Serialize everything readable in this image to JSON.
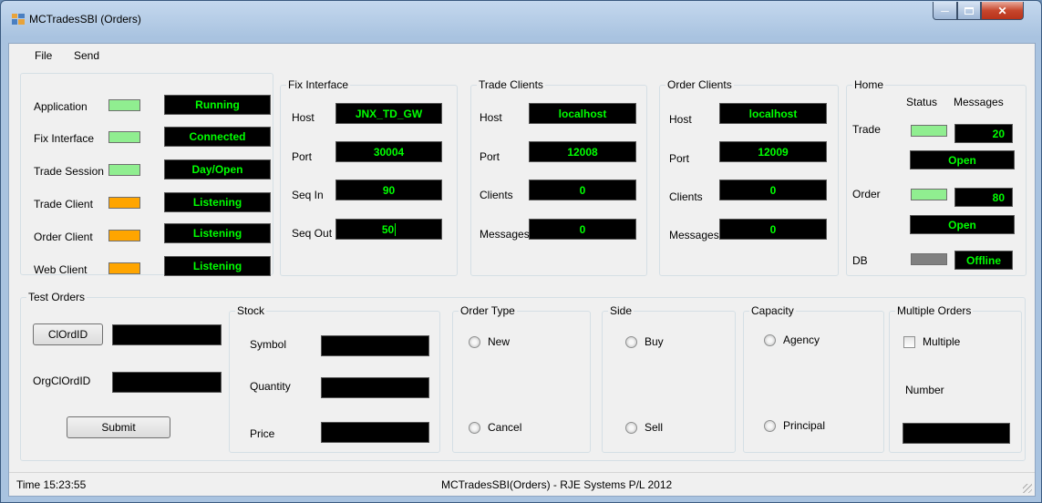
{
  "window": {
    "title": "MCTradesSBI (Orders)"
  },
  "menu": [
    "File",
    "Send"
  ],
  "status_panel": {
    "rows": [
      {
        "label": "Application",
        "led": "green",
        "value": "Running"
      },
      {
        "label": "Fix Interface",
        "led": "green",
        "value": "Connected"
      },
      {
        "label": "Trade Session",
        "led": "green",
        "value": "Day/Open"
      },
      {
        "label": "Trade Client",
        "led": "orange",
        "value": "Listening"
      },
      {
        "label": "Order Client",
        "led": "orange",
        "value": "Listening"
      },
      {
        "label": "Web Client",
        "led": "orange",
        "value": "Listening"
      }
    ]
  },
  "fix_interface": {
    "title": "Fix Interface",
    "host_label": "Host",
    "host": "JNX_TD_GW",
    "port_label": "Port",
    "port": "30004",
    "seqin_label": "Seq In",
    "seqin": "90",
    "seqout_label": "Seq Out",
    "seqout": "50"
  },
  "trade_clients": {
    "title": "Trade Clients",
    "host_label": "Host",
    "host": "localhost",
    "port_label": "Port",
    "port": "12008",
    "clients_label": "Clients",
    "clients": "0",
    "messages_label": "Messages",
    "messages": "0"
  },
  "order_clients": {
    "title": "Order Clients",
    "host_label": "Host",
    "host": "localhost",
    "port_label": "Port",
    "port": "12009",
    "clients_label": "Clients",
    "clients": "0",
    "messages_label": "Messages",
    "messages": "0"
  },
  "home": {
    "title": "Home",
    "status_header": "Status",
    "messages_header": "Messages",
    "trade_label": "Trade",
    "trade_messages": "20",
    "trade_state": "Open",
    "order_label": "Order",
    "order_messages": "80",
    "order_state": "Open",
    "db_label": "DB",
    "db_state": "Offline"
  },
  "test_orders": {
    "title": "Test Orders",
    "clordid_button": "ClOrdID",
    "orgclordid_label": "OrgClOrdID",
    "submit_button": "Submit"
  },
  "stock": {
    "title": "Stock",
    "symbol_label": "Symbol",
    "quantity_label": "Quantity",
    "price_label": "Price"
  },
  "order_type": {
    "title": "Order Type",
    "new_label": "New",
    "cancel_label": "Cancel"
  },
  "side": {
    "title": "Side",
    "buy_label": "Buy",
    "sell_label": "Sell"
  },
  "capacity": {
    "title": "Capacity",
    "agency_label": "Agency",
    "principal_label": "Principal"
  },
  "multiple_orders": {
    "title": "Multiple Orders",
    "multiple_label": "Multiple",
    "number_label": "Number"
  },
  "statusbar": {
    "time": "Time  15:23:55",
    "center": "MCTradesSBI(Orders) - RJE Systems P/L 2012"
  },
  "colors": {
    "led_green": "#90ee90",
    "led_orange": "#ffa500",
    "led_gray": "#808080",
    "lcd_text": "#00ff00",
    "lcd_bg": "#000000"
  }
}
